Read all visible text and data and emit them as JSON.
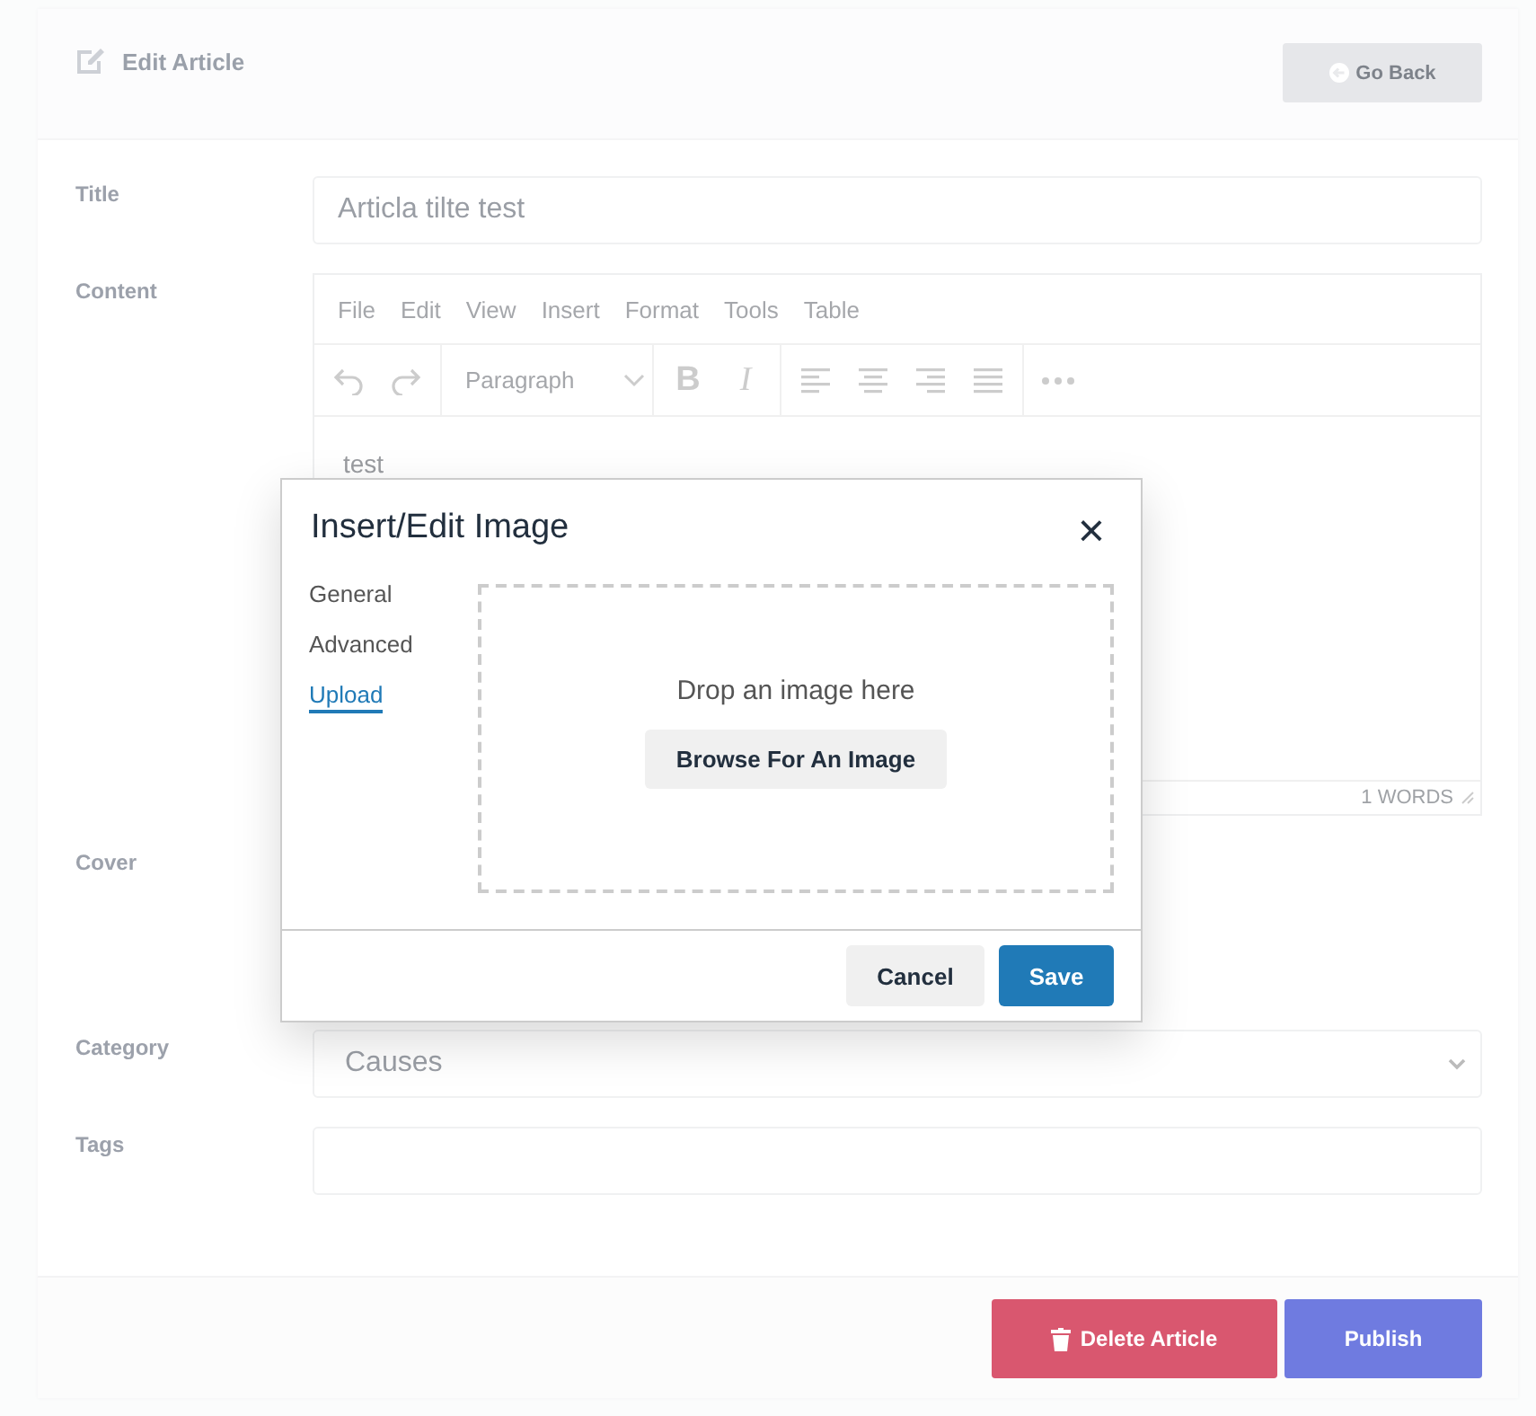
{
  "header": {
    "title": "Edit Article",
    "go_back": "Go Back"
  },
  "fields": [
    {
      "kind": "text",
      "label": "Title",
      "value": "Articla tilte test"
    },
    {
      "kind": "editor",
      "label": "Content",
      "menu": [
        "File",
        "Edit",
        "View",
        "Insert",
        "Format",
        "Tools",
        "Table"
      ],
      "block_format": "Paragraph",
      "bold": "B",
      "italic": "I",
      "body": "test",
      "word_count": "1 WORDS"
    },
    {
      "kind": "cover",
      "label": "Cover"
    },
    {
      "kind": "select",
      "label": "Category",
      "value": "Causes"
    },
    {
      "kind": "text",
      "label": "Tags"
    }
  ],
  "footer": {
    "delete": "Delete Article",
    "publish": "Publish"
  },
  "dialog": {
    "title": "Insert/Edit Image",
    "close": "×",
    "tabs": [
      {
        "label": "General",
        "selected": false
      },
      {
        "label": "Advanced",
        "selected": false
      },
      {
        "label": "Upload",
        "selected": true
      }
    ],
    "drop_text": "Drop an image here",
    "browse": "Browse For An Image",
    "cancel": "Cancel",
    "save": "Save"
  }
}
